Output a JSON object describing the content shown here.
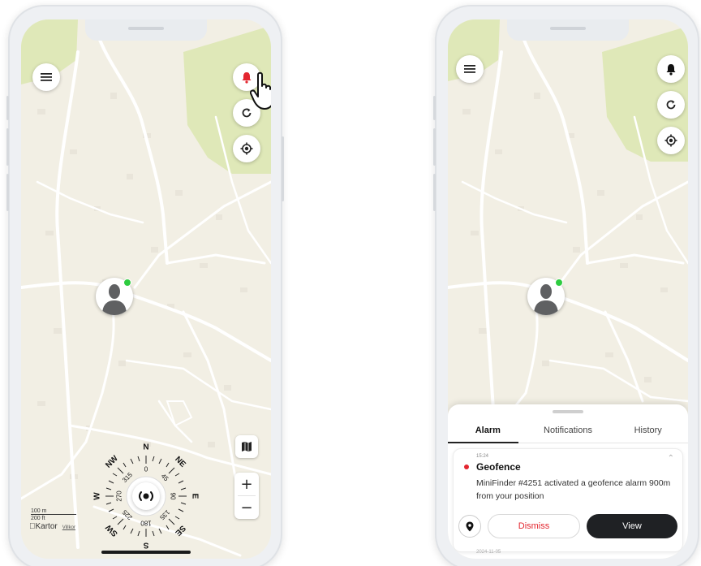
{
  "left_phone": {
    "attribution": {
      "brand": "Kartor",
      "legal": "Villkor"
    },
    "scale": {
      "metric": "100 m",
      "imperial": "200 ft"
    },
    "zoom": {
      "in": "+",
      "out": "−"
    },
    "bell_color": "#e3262f",
    "compass": {
      "labels": [
        "N",
        "NE",
        "E",
        "SE",
        "S",
        "SW",
        "W",
        "NW"
      ],
      "degrees": [
        "0",
        "45",
        "90",
        "135",
        "180",
        "225",
        "270",
        "315"
      ]
    }
  },
  "right_phone": {
    "tabs": [
      "Alarm",
      "Notifications",
      "History"
    ],
    "active_tab": "Alarm",
    "alarm_card": {
      "time": "15:24",
      "title": "Geofence",
      "message": "MiniFinder #4251 activated a geofence alarm 900m from your position",
      "dismiss_label": "Dismiss",
      "view_label": "View",
      "next_date": "2024-11-05"
    }
  },
  "colors": {
    "map_bg": "#f2efe4",
    "park": "#dfe8b8",
    "road": "#ffffff",
    "alert": "#e3262f",
    "online": "#2ecc40"
  }
}
